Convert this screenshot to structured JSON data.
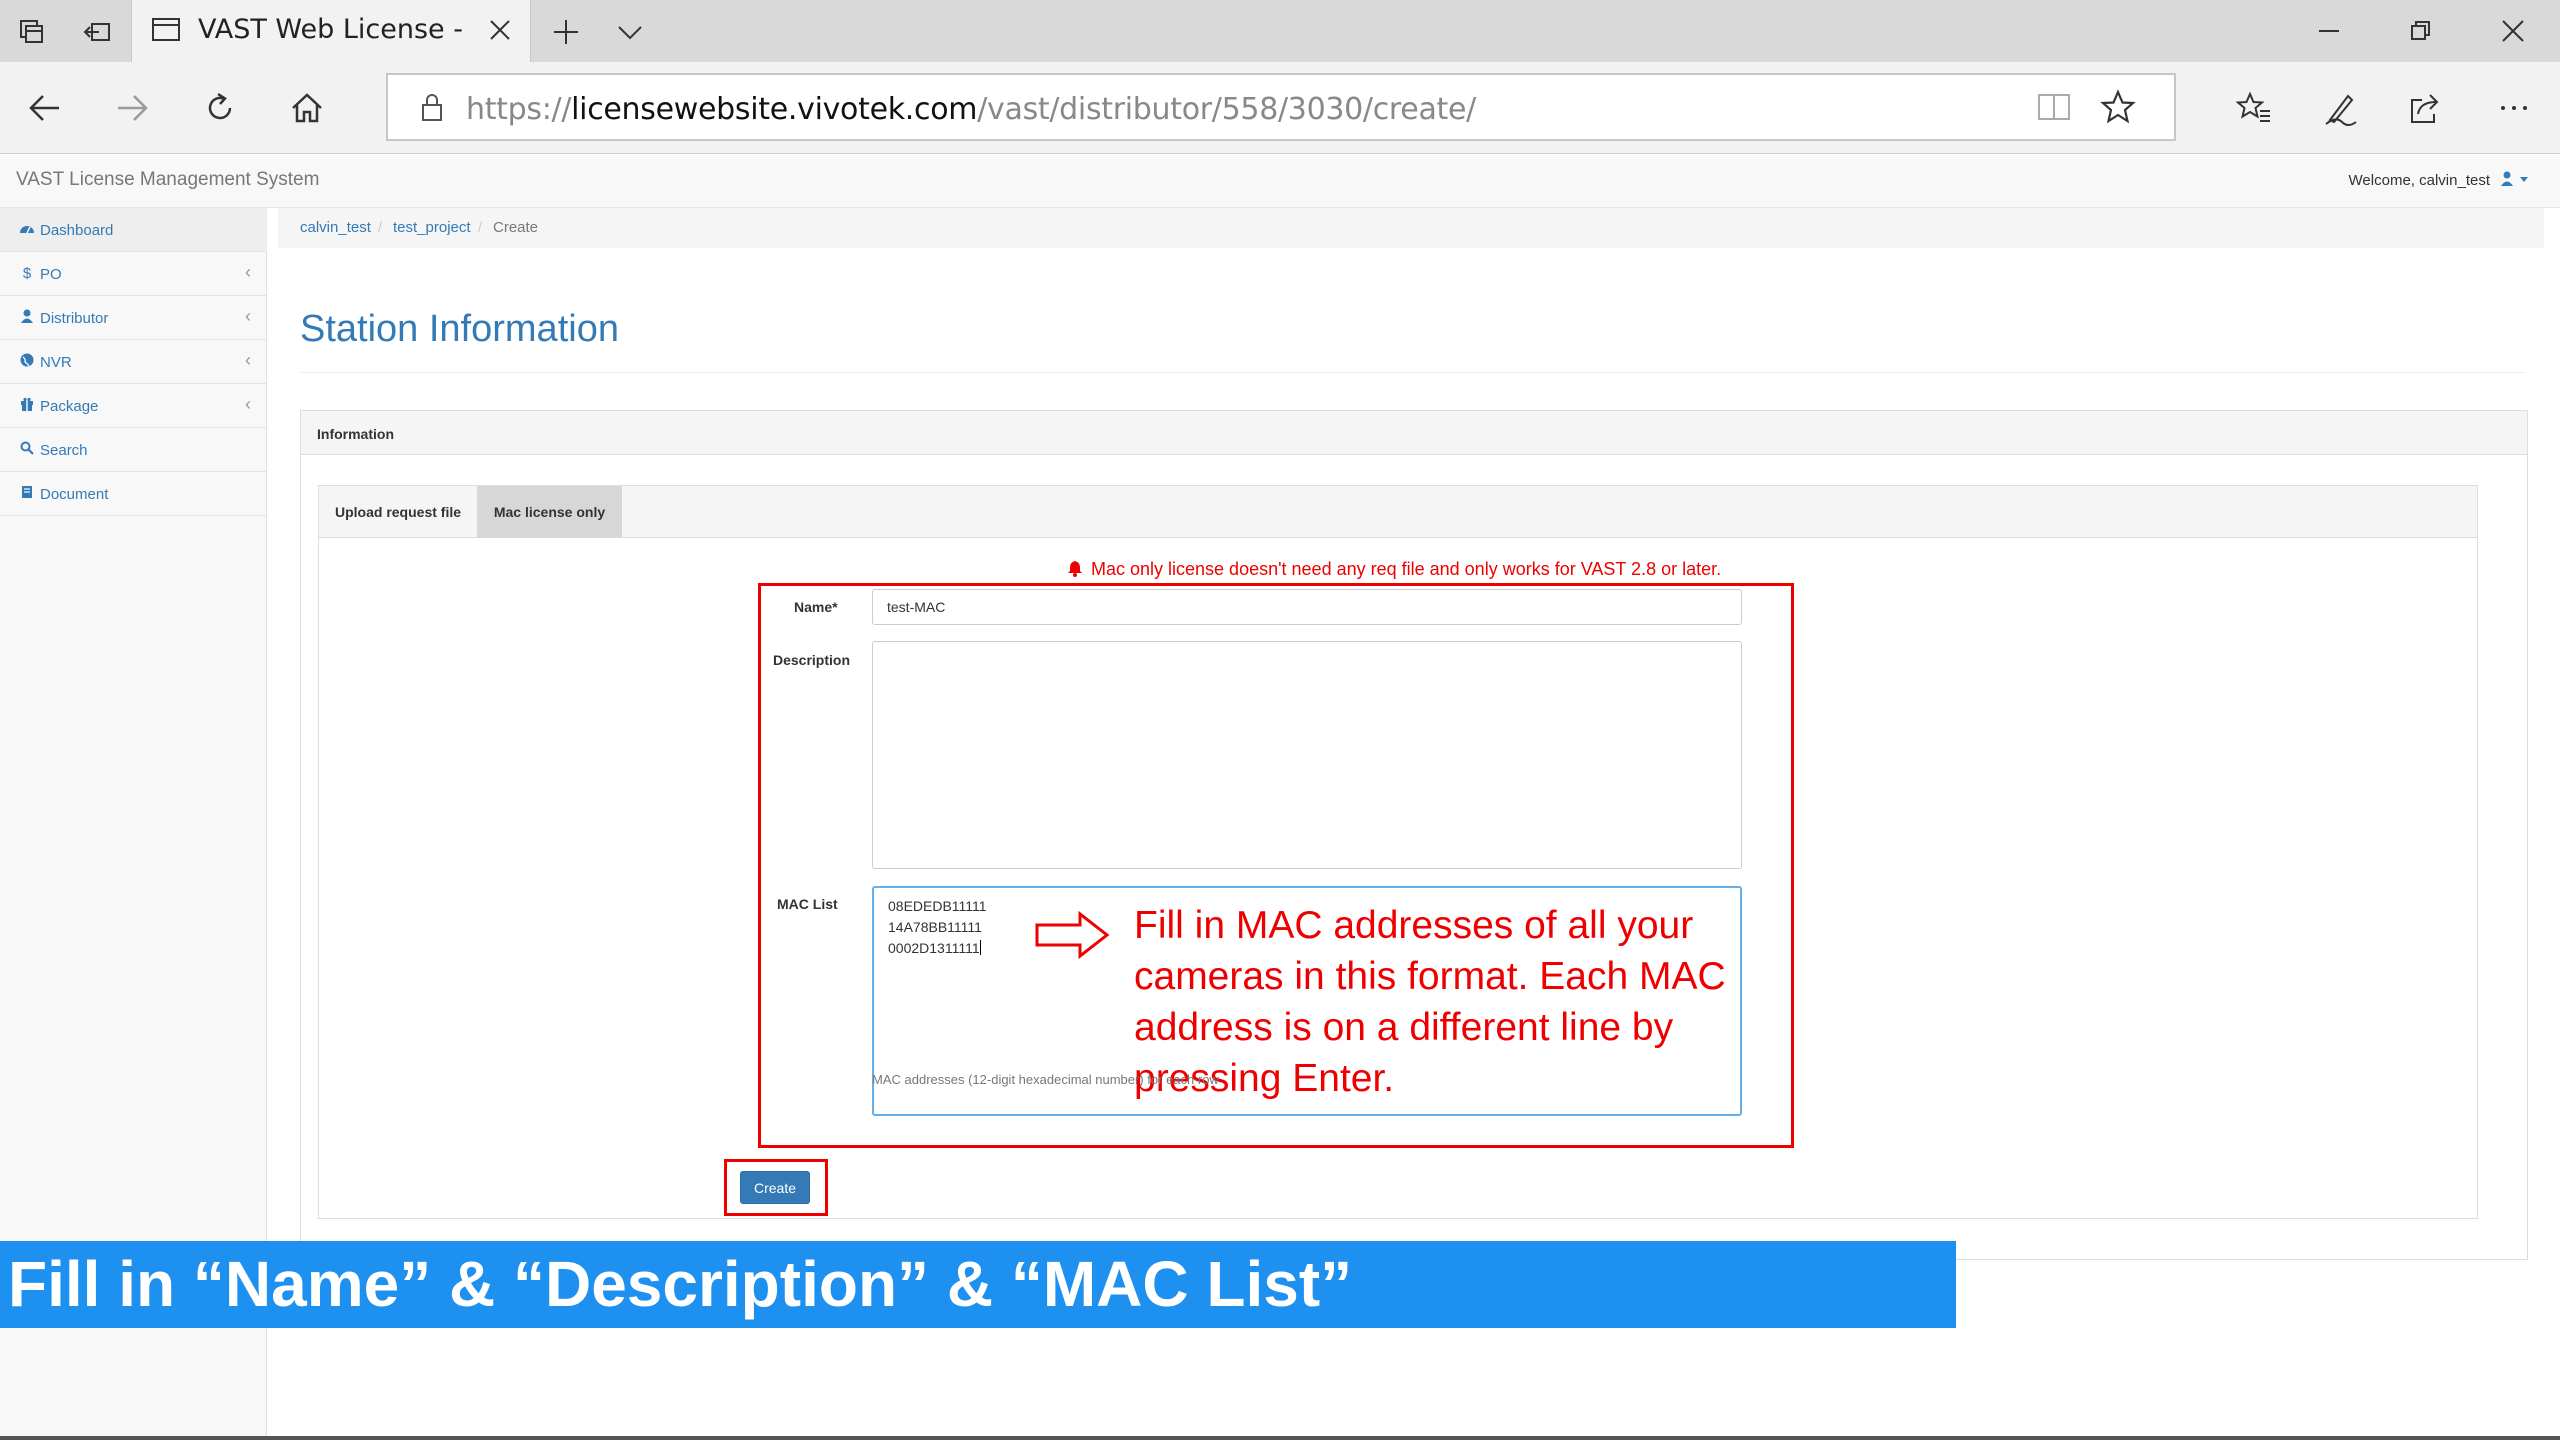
{
  "browser": {
    "tab_title": "VAST Web License - VIV",
    "url_scheme": "https://",
    "url_host": "licensewebsite.vivotek.com",
    "url_path": "/vast/distributor/558/3030/create/"
  },
  "app": {
    "title": "VAST License Management System",
    "welcome": "Welcome, calvin_test"
  },
  "sidebar": {
    "items": [
      {
        "label": "Dashboard",
        "icon": "dashboard-icon"
      },
      {
        "label": "PO",
        "icon": "dollar-icon"
      },
      {
        "label": "Distributor",
        "icon": "user-icon"
      },
      {
        "label": "NVR",
        "icon": "globe-icon"
      },
      {
        "label": "Package",
        "icon": "gift-icon"
      },
      {
        "label": "Search",
        "icon": "search-icon"
      },
      {
        "label": "Document",
        "icon": "book-icon"
      }
    ]
  },
  "breadcrumb": {
    "items": [
      "calvin_test",
      "test_project",
      "Create"
    ],
    "separator": "/"
  },
  "page": {
    "title": "Station Information",
    "panel_heading": "Information",
    "tabs": [
      "Upload request file",
      "Mac license only"
    ],
    "warning": "Mac only license doesn't need any req file and only works for VAST 2.8 or later.",
    "name_label": "Name*",
    "name_value": "test-MAC",
    "description_label": "Description",
    "mac_label": "MAC List",
    "mac_values": [
      "08EDEDB11111",
      "14A78BB11111",
      "0002D1311111"
    ],
    "mac_help": "MAC addresses (12-digit hexadecimal number) for each row",
    "create_label": "Create"
  },
  "annotations": {
    "note": "Fill in MAC addresses of all your cameras in this format. Each MAC address is on a different line by pressing Enter.",
    "banner": "Fill in “Name” & “Description” & “MAC List”"
  },
  "colors": {
    "link": "#337ab7",
    "warning": "#e00000",
    "banner": "#1e90f0"
  }
}
